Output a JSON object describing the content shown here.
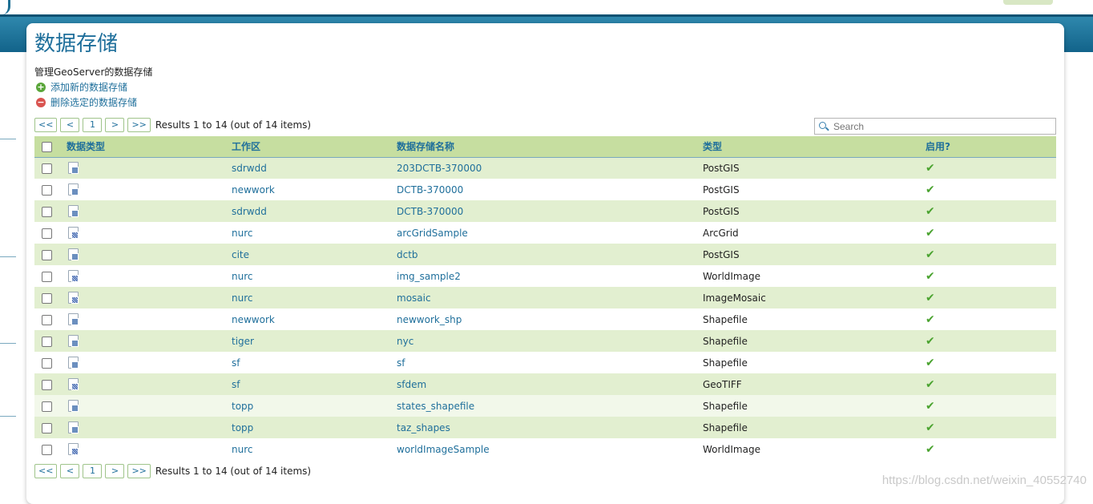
{
  "page": {
    "title": "数据存储",
    "description": "管理GeoServer的数据存储",
    "actions": {
      "add": "添加新的数据存储",
      "remove": "删除选定的数据存储"
    }
  },
  "pager": {
    "first": "<<",
    "prev": "<",
    "page": "1",
    "next": ">",
    "last": ">>",
    "results": "Results 1 to 14 (out of 14 items)"
  },
  "search": {
    "placeholder": "Search"
  },
  "table": {
    "headers": {
      "type_icon": "数据类型",
      "workspace": "工作区",
      "name": "数据存储名称",
      "type": "类型",
      "enabled": "启用?"
    },
    "rows": [
      {
        "workspace": "sdrwdd",
        "name": "203DCTB-370000",
        "type": "PostGIS",
        "icon": "vector-store-icon"
      },
      {
        "workspace": "newwork",
        "name": "DCTB-370000",
        "type": "PostGIS",
        "icon": "vector-store-icon"
      },
      {
        "workspace": "sdrwdd",
        "name": "DCTB-370000",
        "type": "PostGIS",
        "icon": "vector-store-icon"
      },
      {
        "workspace": "nurc",
        "name": "arcGridSample",
        "type": "ArcGrid",
        "icon": "raster-store-icon"
      },
      {
        "workspace": "cite",
        "name": "dctb",
        "type": "PostGIS",
        "icon": "vector-store-icon"
      },
      {
        "workspace": "nurc",
        "name": "img_sample2",
        "type": "WorldImage",
        "icon": "raster-store-icon"
      },
      {
        "workspace": "nurc",
        "name": "mosaic",
        "type": "ImageMosaic",
        "icon": "raster-store-icon"
      },
      {
        "workspace": "newwork",
        "name": "newwork_shp",
        "type": "Shapefile",
        "icon": "vector-store-icon"
      },
      {
        "workspace": "tiger",
        "name": "nyc",
        "type": "Shapefile",
        "icon": "vector-store-icon"
      },
      {
        "workspace": "sf",
        "name": "sf",
        "type": "Shapefile",
        "icon": "vector-store-icon"
      },
      {
        "workspace": "sf",
        "name": "sfdem",
        "type": "GeoTIFF",
        "icon": "raster-store-icon"
      },
      {
        "workspace": "topp",
        "name": "states_shapefile",
        "type": "Shapefile",
        "icon": "vector-store-icon"
      },
      {
        "workspace": "topp",
        "name": "taz_shapes",
        "type": "Shapefile",
        "icon": "vector-store-icon"
      },
      {
        "workspace": "nurc",
        "name": "worldImageSample",
        "type": "WorldImage",
        "icon": "raster-store-icon"
      }
    ]
  },
  "enabled_mark": "✔",
  "watermark": "https://blog.csdn.net/weixin_40552740",
  "colors": {
    "accent": "#1f6f9b",
    "header_bg": "#c6dea0",
    "row_alt": "#e2efd0",
    "check": "#4aa32f"
  }
}
